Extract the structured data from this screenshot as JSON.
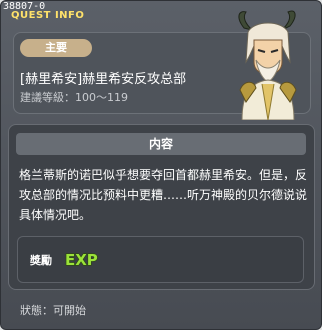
{
  "window": {
    "quest_id": "38807-0",
    "title": "QUEST INFO"
  },
  "quest": {
    "tag": "主要",
    "title": "[赫里希安]赫里希安反攻总部",
    "level": "建議等級：100～119"
  },
  "content": {
    "header": "内容",
    "text": "格兰蒂斯的诺巴似乎想要夺回首都赫里希安。但是，反攻总部的情况比预料中更糟……听万神殿的贝尔德说说具体情况吧。"
  },
  "reward": {
    "label": "獎勵",
    "exp_text": "EXP"
  },
  "status": {
    "text": "狀態：可開始"
  },
  "icons": {
    "portrait": "npc-portrait-icon",
    "exp": "exp-icon"
  },
  "colors": {
    "title_accent": "#ffe26a",
    "tag_background": "#c7b08b",
    "exp_green": "#9be23a"
  }
}
